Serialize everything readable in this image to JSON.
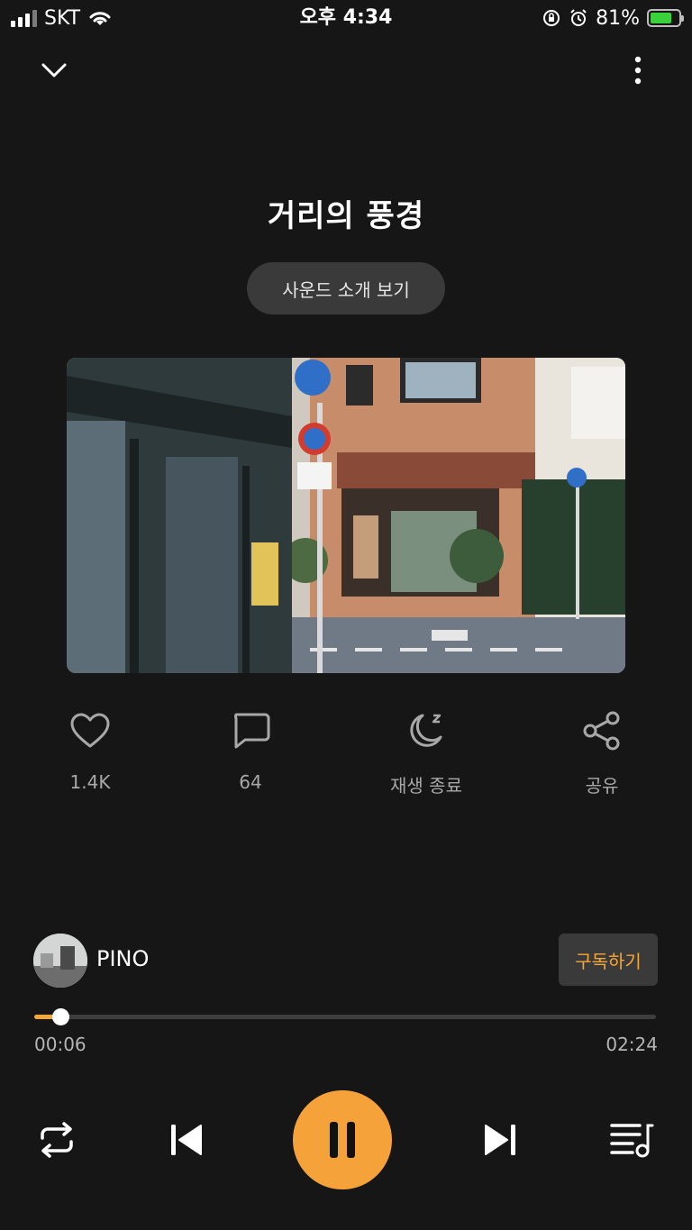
{
  "status_bar": {
    "carrier": "SKT",
    "time": "오후 4:34",
    "battery": "81%",
    "battery_level": 0.81
  },
  "header": {
    "collapse_icon": "chevron-down-icon",
    "more_icon": "more-vertical-icon"
  },
  "track": {
    "title": "거리의 풍경",
    "sound_intro_label": "사운드 소개 보기"
  },
  "actions": {
    "like": {
      "icon": "heart-icon",
      "label": "1.4K"
    },
    "comment": {
      "icon": "comment-icon",
      "label": "64"
    },
    "sleep": {
      "icon": "moon-sleep-icon",
      "label": "재생 종료"
    },
    "share": {
      "icon": "share-icon",
      "label": "공유"
    }
  },
  "artist": {
    "name": "PINO",
    "subscribe_label": "구독하기"
  },
  "progress": {
    "current": "00:06",
    "total": "02:24",
    "fraction": 0.0417
  },
  "controls": {
    "repeat_icon": "repeat-icon",
    "previous_icon": "skip-previous-icon",
    "pause_icon": "pause-icon",
    "next_icon": "skip-next-icon",
    "playlist_icon": "playlist-icon"
  },
  "colors": {
    "background": "#161616",
    "accent": "#f6a23a",
    "muted_text": "#a8a8a8",
    "button_bg": "#3a3a3a"
  }
}
